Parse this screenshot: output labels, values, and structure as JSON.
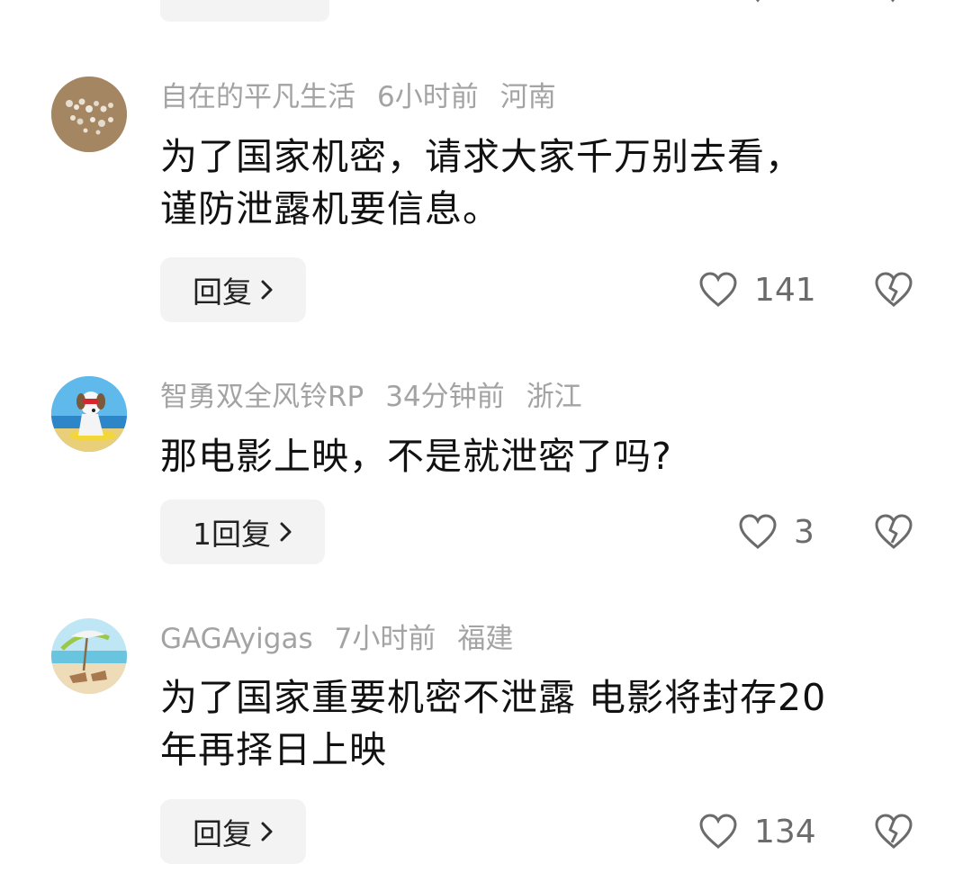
{
  "comments": [
    {
      "username": "自在的平凡生活",
      "time": "6小时前",
      "location": "河南",
      "text_line1": "为了国家机密，请求大家千万别去看，",
      "text_line2": "谨防泄露机要信息。",
      "reply_label": "回复",
      "likes": "141",
      "avatar_icon": "sand-stones-avatar"
    },
    {
      "username": "智勇双全风铃RP",
      "time": "34分钟前",
      "location": "浙江",
      "text_line1": "那电影上映，不是就泄密了吗?",
      "reply_label": "1回复",
      "likes": "3",
      "avatar_icon": "dog-sunglasses-avatar"
    },
    {
      "username": "GAGAyigas",
      "time": "7小时前",
      "location": "福建",
      "text_line1": "为了国家重要机密不泄露 电影将封存20",
      "text_line2": "年再择日上映",
      "reply_label": "回复",
      "likes": "134",
      "avatar_icon": "beach-chairs-avatar"
    }
  ],
  "icons": {
    "like": "heart-outline-icon",
    "dislike": "broken-heart-icon",
    "reply_arrow": "chevron-right-icon"
  },
  "colors": {
    "meta_text": "#a3a3a3",
    "body_text": "#111111",
    "reply_bg": "#f3f3f3",
    "icon_gray": "#6b6b6b"
  }
}
